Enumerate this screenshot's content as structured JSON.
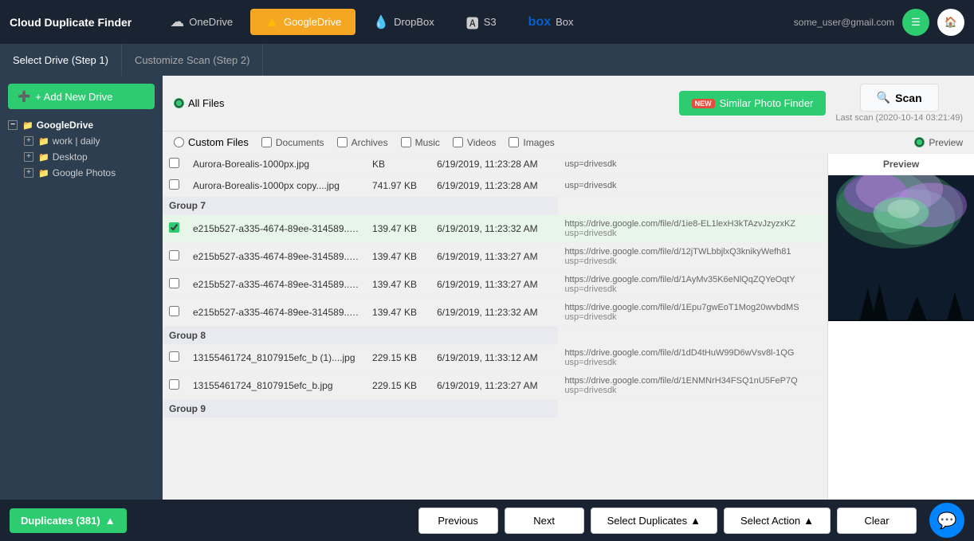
{
  "app": {
    "title": "Cloud Duplicate Finder",
    "user_email": "some_user@gmail.com"
  },
  "nav": {
    "tabs": [
      {
        "id": "onedrive",
        "label": "OneDrive",
        "active": false
      },
      {
        "id": "googledrive",
        "label": "GoogleDrive",
        "active": true
      },
      {
        "id": "dropbox",
        "label": "DropBox",
        "active": false
      },
      {
        "id": "s3",
        "label": "S3",
        "active": false
      },
      {
        "id": "box",
        "label": "Box",
        "active": false
      }
    ]
  },
  "steps": [
    {
      "id": "step1",
      "label": "Select Drive (Step 1)",
      "active": true
    },
    {
      "id": "step2",
      "label": "Customize Scan (Step 2)",
      "active": false
    }
  ],
  "sidebar": {
    "add_drive_label": "+ Add New Drive",
    "tree": [
      {
        "id": "googledrive",
        "label": "GoogleDrive",
        "level": 0,
        "expanded": true,
        "children": [
          {
            "id": "work_daily",
            "label": "work | daily",
            "level": 1,
            "expanded": false
          },
          {
            "id": "desktop",
            "label": "Desktop",
            "level": 1,
            "expanded": false
          },
          {
            "id": "google_photos",
            "label": "Google Photos",
            "level": 1,
            "expanded": false
          }
        ]
      }
    ]
  },
  "scan_options": {
    "all_files_label": "All Files",
    "custom_files_label": "Custom Files",
    "file_types": [
      "Documents",
      "Archives",
      "Music",
      "Videos",
      "Images"
    ],
    "similar_photo_btn": "Similar Photo Finder",
    "new_badge": "NEW",
    "scan_btn": "Scan",
    "last_scan": "Last scan (2020-10-14 03:21:49)",
    "preview_label": "Preview"
  },
  "preview": {
    "header": "Preview"
  },
  "table": {
    "groups": [
      {
        "name": "",
        "rows": [
          {
            "checked": false,
            "filename": "Aurora-Borealis-1000px.jpg",
            "size": "KB",
            "date": "6/19/2019, 11:23:28 AM",
            "link": "usp=drivesdk"
          },
          {
            "checked": false,
            "filename": "Aurora-Borealis-1000px copy....jpg",
            "size": "741.97 KB",
            "date": "6/19/2019, 11:23:28 AM",
            "link": "usp=drivesdk"
          }
        ]
      },
      {
        "name": "Group 7",
        "rows": [
          {
            "checked": true,
            "filename": "e215b527-a335-4674-89ee-314589....jpg",
            "size": "139.47 KB",
            "date": "6/19/2019, 11:23:32 AM",
            "link": "https://drive.google.com/file/d/1ie8-EL1lexH3kTAzvJzyzxKZ\nusp=drivesdk"
          },
          {
            "checked": false,
            "filename": "e215b527-a335-4674-89ee-314589....jpg",
            "size": "139.47 KB",
            "date": "6/19/2019, 11:33:27 AM",
            "link": "https://drive.google.com/file/d/12jTWLbbjlxQ3knikyWefh81\nusp=drivesdk"
          },
          {
            "checked": false,
            "filename": "e215b527-a335-4674-89ee-314589....jpg",
            "size": "139.47 KB",
            "date": "6/19/2019, 11:33:27 AM",
            "link": "https://drive.google.com/file/d/1AyMv35K6eNlQqZQYeOqtY\nusp=drivesdk"
          },
          {
            "checked": false,
            "filename": "e215b527-a335-4674-89ee-314589....jpg",
            "size": "139.47 KB",
            "date": "6/19/2019, 11:23:32 AM",
            "link": "https://drive.google.com/file/d/1Epu7gwEoT1Mog20wvbdMS\nusp=drivesdk"
          }
        ]
      },
      {
        "name": "Group 8",
        "rows": [
          {
            "checked": false,
            "filename": "13155461724_8107915efc_b (1)....jpg",
            "size": "229.15 KB",
            "date": "6/19/2019, 11:33:12 AM",
            "link": "https://drive.google.com/file/d/1dD4tHuW99D6wVsv8l-1QG\nusp=drivesdk"
          },
          {
            "checked": false,
            "filename": "13155461724_8107915efc_b.jpg",
            "size": "229.15 KB",
            "date": "6/19/2019, 11:23:27 AM",
            "link": "https://drive.google.com/file/d/1ENMNrH34FSQ1nU5FeP7Q\nusp=drivesdk"
          }
        ]
      },
      {
        "name": "Group 9",
        "rows": []
      }
    ]
  },
  "bottom_bar": {
    "duplicates_label": "Duplicates (381)",
    "previous_label": "Previous",
    "next_label": "Next",
    "select_duplicates_label": "Select Duplicates",
    "select_action_label": "Select Action",
    "clear_label": "Clear"
  }
}
